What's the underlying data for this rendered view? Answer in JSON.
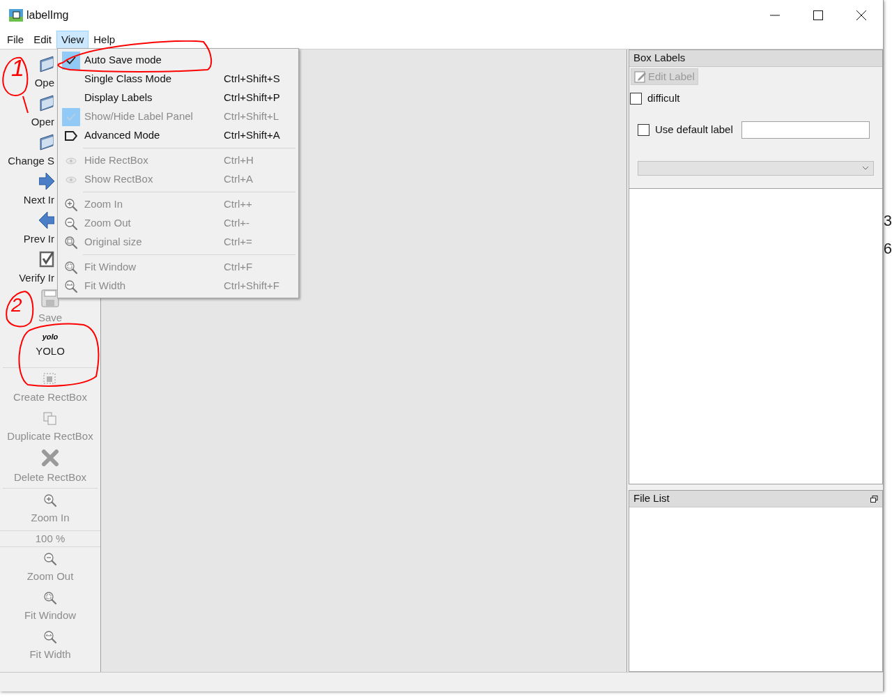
{
  "window": {
    "title": "labelImg"
  },
  "menubar": [
    {
      "label": "File",
      "selected": false
    },
    {
      "label": "Edit",
      "selected": false
    },
    {
      "label": "View",
      "selected": true
    },
    {
      "label": "Help",
      "selected": false
    }
  ],
  "toolbar": [
    {
      "kind": "cut",
      "label": "Ope",
      "disabled": false
    },
    {
      "kind": "cut",
      "label": "Oper",
      "disabled": false
    },
    {
      "kind": "cut",
      "label": "Change S",
      "disabled": false
    },
    {
      "kind": "cut",
      "label": "Next Ir",
      "disabled": false
    },
    {
      "kind": "cut",
      "label": "Prev Ir",
      "disabled": false
    },
    {
      "kind": "cut",
      "label": "Verify Ir",
      "disabled": false
    },
    {
      "kind": "full",
      "label": "Save",
      "disabled": true
    },
    {
      "kind": "full",
      "icon_text": "yolo",
      "label": "YOLO",
      "disabled": false
    },
    {
      "kind": "separator"
    },
    {
      "kind": "full",
      "label": "Create RectBox",
      "disabled": true
    },
    {
      "kind": "full",
      "label": "Duplicate RectBox",
      "disabled": true
    },
    {
      "kind": "full",
      "label": "Delete RectBox",
      "disabled": true
    },
    {
      "kind": "separator"
    },
    {
      "kind": "full",
      "label": "Zoom In",
      "disabled": true
    },
    {
      "kind": "spin",
      "label": "100 %",
      "disabled": true
    },
    {
      "kind": "full",
      "label": "Zoom Out",
      "disabled": true
    },
    {
      "kind": "full",
      "label": "Fit Window",
      "disabled": true
    },
    {
      "kind": "full",
      "label": "Fit Width",
      "disabled": true
    }
  ],
  "view_menu": [
    {
      "kind": "check",
      "label": "Auto Save mode",
      "checked": true,
      "disabled": false
    },
    {
      "kind": "check",
      "label": "Single Class Mode",
      "shortcut": "Ctrl+Shift+S",
      "checked": false,
      "disabled": false
    },
    {
      "kind": "check",
      "label": "Display Labels",
      "shortcut": "Ctrl+Shift+P",
      "checked": false,
      "disabled": false
    },
    {
      "kind": "check",
      "label": "Show/Hide Label Panel",
      "shortcut": "Ctrl+Shift+L",
      "checked": true,
      "disabled": true
    },
    {
      "kind": "tag",
      "label": "Advanced Mode",
      "shortcut": "Ctrl+Shift+A",
      "disabled": false
    },
    {
      "kind": "separator"
    },
    {
      "kind": "eye",
      "label": "Hide RectBox",
      "shortcut": "Ctrl+H",
      "disabled": true
    },
    {
      "kind": "eye",
      "label": "Show RectBox",
      "shortcut": "Ctrl+A",
      "disabled": true
    },
    {
      "kind": "separator"
    },
    {
      "kind": "zoom-in",
      "label": "Zoom In",
      "shortcut": "Ctrl++",
      "disabled": true
    },
    {
      "kind": "zoom-out",
      "label": "Zoom Out",
      "shortcut": "Ctrl+-",
      "disabled": true
    },
    {
      "kind": "zoom-original",
      "label": "Original size",
      "shortcut": "Ctrl+=",
      "disabled": true
    },
    {
      "kind": "separator"
    },
    {
      "kind": "fit-window",
      "label": "Fit Window",
      "shortcut": "Ctrl+F",
      "disabled": true
    },
    {
      "kind": "fit-width",
      "label": "Fit Width",
      "shortcut": "Ctrl+Shift+F",
      "disabled": true
    }
  ],
  "box_labels": {
    "title": "Box Labels",
    "edit_button": {
      "label": "Edit Label",
      "disabled": true
    },
    "difficult": {
      "label": "difficult",
      "checked": false
    },
    "use_default_label": {
      "label": "Use default label",
      "checked": false
    },
    "combo_disabled": true
  },
  "file_list": {
    "title": "File List"
  },
  "background": {
    "edge_digits": [
      "3",
      "6"
    ]
  },
  "annotations": [
    "1",
    "2"
  ]
}
